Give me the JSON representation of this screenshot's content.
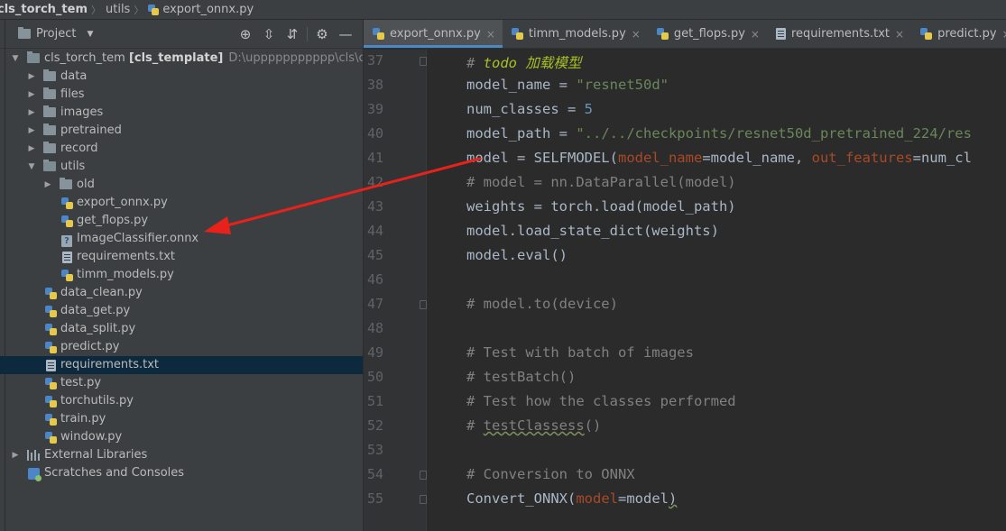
{
  "navbar": {
    "crumbs": [
      "cls_torch_tem",
      "utils",
      "export_onnx.py"
    ]
  },
  "project_panel": {
    "title": "Project",
    "toolbar_icons": [
      "locate-icon",
      "expand-all-icon",
      "collapse-all-icon",
      "gear-icon",
      "minimize-icon"
    ],
    "tree": [
      {
        "label": "cls_torch_tem",
        "module": "[cls_template]",
        "path": "D:\\uppppppppppp\\cls\\cls_torch",
        "type": "folder-open"
      },
      {
        "label": "data",
        "type": "folder"
      },
      {
        "label": "files",
        "type": "folder"
      },
      {
        "label": "images",
        "type": "folder"
      },
      {
        "label": "pretrained",
        "type": "folder"
      },
      {
        "label": "record",
        "type": "folder"
      },
      {
        "label": "utils",
        "type": "folder-open"
      },
      {
        "label": "old",
        "type": "folder"
      },
      {
        "label": "export_onnx.py",
        "type": "py"
      },
      {
        "label": "get_flops.py",
        "type": "py"
      },
      {
        "label": "ImageClassifier.onnx",
        "type": "unknown"
      },
      {
        "label": "requirements.txt",
        "type": "txt"
      },
      {
        "label": "timm_models.py",
        "type": "py"
      },
      {
        "label": "data_clean.py",
        "type": "py"
      },
      {
        "label": "data_get.py",
        "type": "py"
      },
      {
        "label": "data_split.py",
        "type": "py"
      },
      {
        "label": "predict.py",
        "type": "py"
      },
      {
        "label": "requirements.txt",
        "type": "txt",
        "selected": true
      },
      {
        "label": "test.py",
        "type": "py"
      },
      {
        "label": "torchutils.py",
        "type": "py"
      },
      {
        "label": "train.py",
        "type": "py"
      },
      {
        "label": "window.py",
        "type": "py"
      },
      {
        "label": "External Libraries",
        "type": "lib"
      },
      {
        "label": "Scratches and Consoles",
        "type": "scratch"
      }
    ]
  },
  "editor": {
    "tabs": [
      {
        "label": "export_onnx.py",
        "active": true
      },
      {
        "label": "timm_models.py"
      },
      {
        "label": "get_flops.py"
      },
      {
        "label": "requirements.txt"
      },
      {
        "label": "predict.py"
      }
    ],
    "close_glyph": "×",
    "line_numbers": [
      "37",
      "38",
      "39",
      "40",
      "41",
      "42",
      "43",
      "44",
      "45",
      "46",
      "47",
      "48",
      "49",
      "50",
      "51",
      "52",
      "53",
      "54",
      "55"
    ],
    "code": {
      "l37a": "# ",
      "l37b": "todo 加载模型",
      "l38a": "model_name = ",
      "l38b": "\"resnet50d\"",
      "l39a": "num_classes = ",
      "l39b": "5",
      "l40a": "model_path = ",
      "l40b": "\"../../checkpoints/resnet50d_pretrained_224/res",
      "l41a": "model = SELFMODEL(",
      "l41b": "model_name",
      "l41c": "=model_name, ",
      "l41d": "out_features",
      "l41e": "=num_cl",
      "l42": "# model = nn.DataParallel(model)",
      "l43": "weights = torch.load(model_path)",
      "l44": "model.load_state_dict(weights)",
      "l45": "model.eval()",
      "l47": "# model.to(device)",
      "l49": "# Test with batch of images",
      "l50": "# testBatch()",
      "l51": "# Test how the classes performed",
      "l52a": "# ",
      "l52b": "testClassess",
      "l52c": "()",
      "l54": "# Conversion to ONNX",
      "l55a": "Convert_ONNX(",
      "l55b": "model",
      "l55c": "=model",
      "l55d": ")"
    }
  },
  "annotation": {
    "arrow_color": "#e8221b"
  }
}
